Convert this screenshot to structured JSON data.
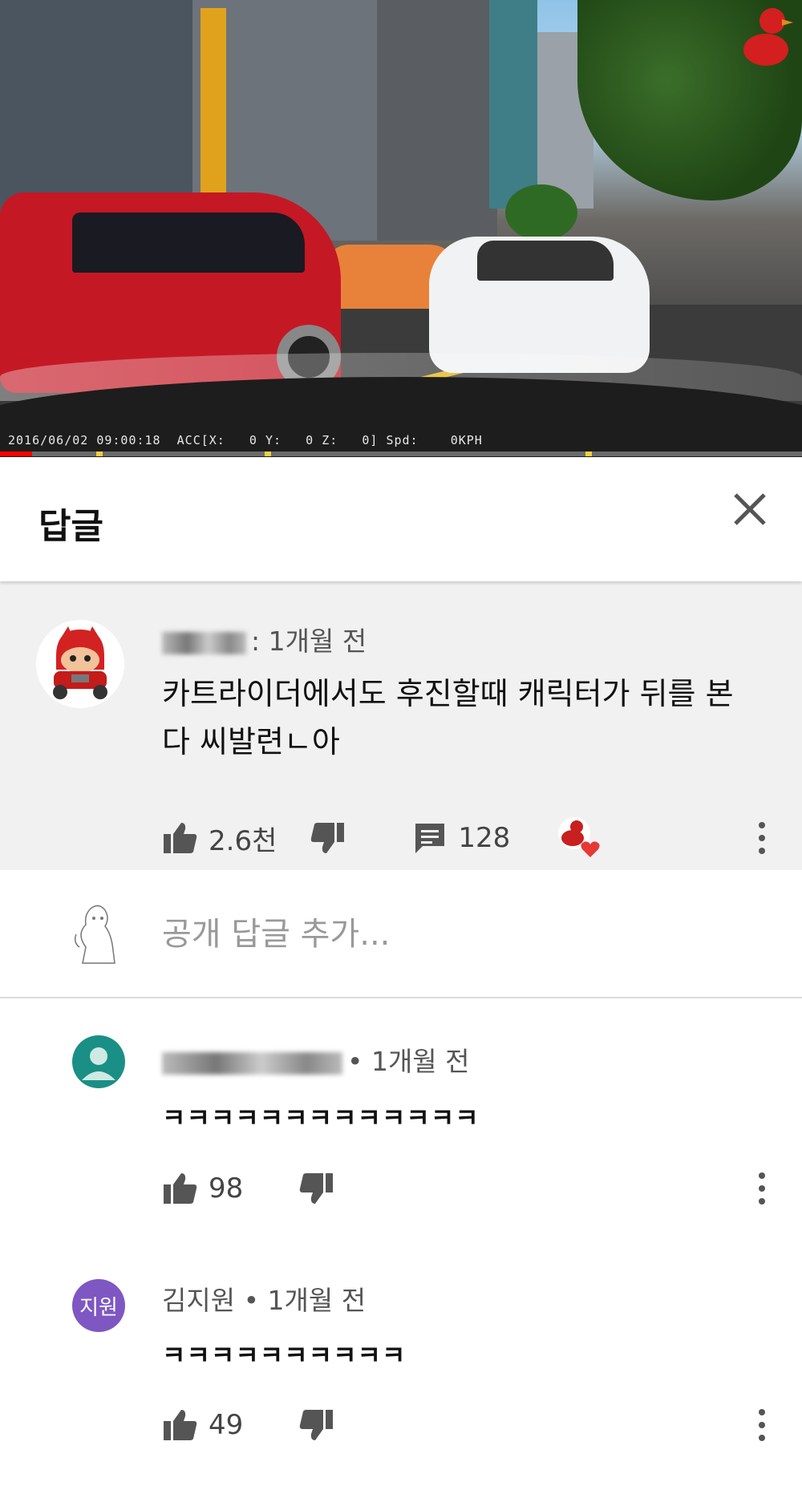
{
  "video": {
    "osd_text": "2016/06/02 09:00:18  ACC[X:   0 Y:   0 Z:   0] Spd:    0KPH",
    "progress_percent": 4,
    "ad_markers_percent": [
      12,
      33,
      73
    ]
  },
  "header": {
    "title": "답글"
  },
  "main_comment": {
    "author_suffix": ": 1개월 전",
    "text": "카트라이더에서도 후진할때 캐릭터가 뒤를 본다 씨발련ㄴ아",
    "likes": "2.6천",
    "reply_count": "128"
  },
  "add_reply": {
    "placeholder": "공개 답글 추가..."
  },
  "replies": [
    {
      "author_suffix": "• 1개월 전",
      "text": "ㅋㅋㅋㅋㅋㅋㅋㅋㅋㅋㅋㅋㅋ",
      "likes": "98",
      "avatar_color": "#1a8f85"
    },
    {
      "author": "김지원 • 1개월 전",
      "avatar_initials": "지원",
      "text": "ㅋㅋㅋㅋㅋㅋㅋㅋㅋㅋ",
      "likes": "49",
      "avatar_color": "#7e57c2"
    }
  ],
  "colors": {
    "progress": "#ff0000",
    "heart": "#e53935",
    "comment_bg": "#f1f1f1"
  }
}
